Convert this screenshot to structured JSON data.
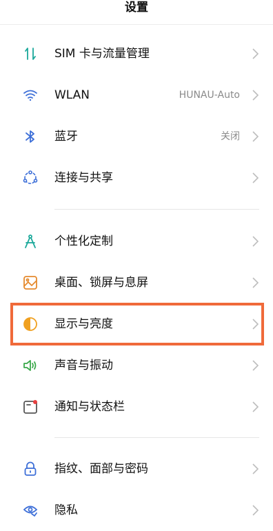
{
  "header": {
    "title": "设置"
  },
  "groups": [
    {
      "items": [
        {
          "label": "SIM 卡与流量管理",
          "value": "",
          "icon": "sim-data-icon"
        },
        {
          "label": "WLAN",
          "value": "HUNAU-Auto",
          "icon": "wifi-icon"
        },
        {
          "label": "蓝牙",
          "value": "关闭",
          "icon": "bluetooth-icon"
        },
        {
          "label": "连接与共享",
          "value": "",
          "icon": "connection-share-icon"
        }
      ]
    },
    {
      "items": [
        {
          "label": "个性化定制",
          "value": "",
          "icon": "personalization-icon"
        },
        {
          "label": "桌面、锁屏与息屏",
          "value": "",
          "icon": "wallpaper-icon"
        },
        {
          "label": "显示与亮度",
          "value": "",
          "icon": "display-brightness-icon"
        },
        {
          "label": "声音与振动",
          "value": "",
          "icon": "sound-icon"
        },
        {
          "label": "通知与状态栏",
          "value": "",
          "icon": "notification-icon"
        }
      ]
    },
    {
      "items": [
        {
          "label": "指纹、面部与密码",
          "value": "",
          "icon": "lock-icon"
        },
        {
          "label": "隐私",
          "value": "",
          "icon": "privacy-icon"
        }
      ]
    }
  ],
  "highlighted_item": "显示与亮度",
  "colors": {
    "highlight_border": "#f06a3a",
    "chevron": "#bdbdbd",
    "value_text": "#8a8a8a"
  }
}
